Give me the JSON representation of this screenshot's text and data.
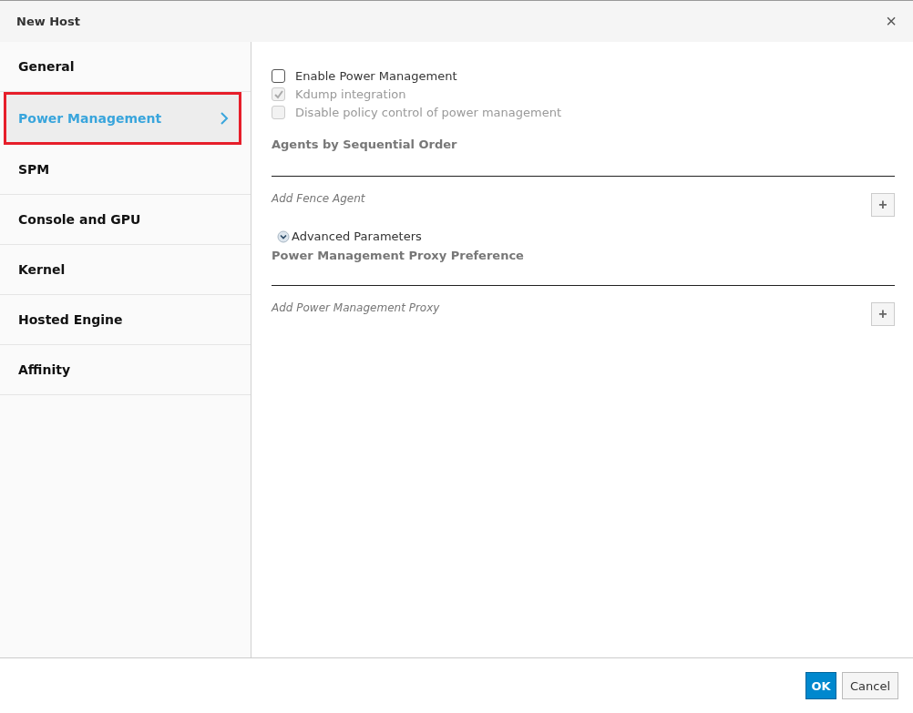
{
  "window": {
    "title": "New Host",
    "close": "×"
  },
  "tabs": [
    {
      "label": "General",
      "selected": false
    },
    {
      "label": "Power Management",
      "selected": true
    },
    {
      "label": "SPM",
      "selected": false
    },
    {
      "label": "Console and GPU",
      "selected": false
    },
    {
      "label": "Kernel",
      "selected": false
    },
    {
      "label": "Hosted Engine",
      "selected": false
    },
    {
      "label": "Affinity",
      "selected": false
    }
  ],
  "options": [
    {
      "label": "Enable Power Management",
      "checked": false,
      "disabled": false
    },
    {
      "label": "Kdump integration",
      "checked": true,
      "disabled": true
    },
    {
      "label": "Disable policy control of power management",
      "checked": false,
      "disabled": true
    }
  ],
  "agents": {
    "title": "Agents by Sequential Order",
    "add_label": "Add Fence Agent",
    "add_button": "+"
  },
  "advanced": {
    "label": "Advanced Parameters",
    "expanded": false
  },
  "proxy": {
    "title": "Power Management Proxy Preference",
    "add_label": "Add Power Management Proxy",
    "add_button": "+"
  },
  "buttons": [
    {
      "label": "OK",
      "kind": "primary"
    },
    {
      "label": "Cancel",
      "kind": "default"
    }
  ]
}
